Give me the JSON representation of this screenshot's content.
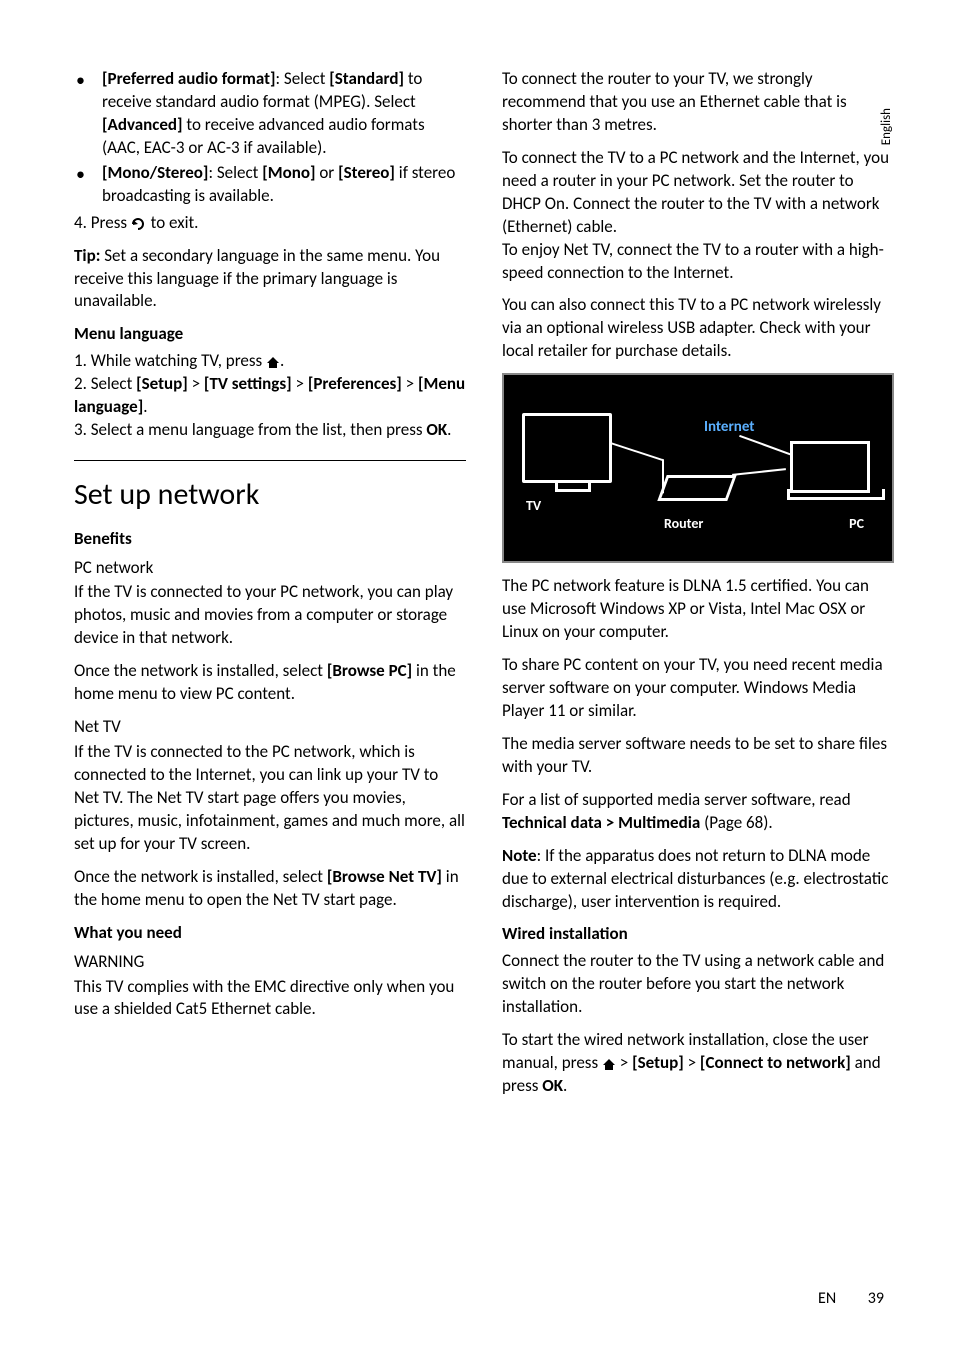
{
  "sideTab": "English",
  "left": {
    "bullet1": {
      "label": "[Preferred audio format]",
      "sep": ": Select ",
      "opt1": "[Standard]",
      "rest1": " to receive standard audio format (MPEG). Select ",
      "opt2": "[Advanced]",
      "rest2": " to receive advanced audio formats (AAC, EAC-3 or AC-3 if available)."
    },
    "bullet2": {
      "label": "[Mono/Stereo]",
      "sep": ": Select ",
      "opt1": "[Mono]",
      "mid": " or ",
      "opt2": "[Stereo]",
      "rest": " if stereo broadcasting is available."
    },
    "step4a": "4. Press ",
    "step4b": " to exit.",
    "tipLabel": "Tip:",
    "tipText": " Set a secondary language in the same menu. You receive this language if the primary language is unavailable.",
    "menuLangH": "Menu language",
    "ml1a": "1. While watching TV, press ",
    "ml1b": ".",
    "ml2a": "2. Select ",
    "ml2b": "[Setup]",
    "ml2c": " > ",
    "ml2d": "[TV settings]",
    "ml2e": " > ",
    "ml2f": "[Preferences]",
    "ml2g": " > ",
    "ml2h": "[Menu language]",
    "ml2i": ".",
    "ml3a": "3. Select a menu language from the list, then press ",
    "ml3b": "OK",
    "ml3c": ".",
    "h1": "Set up network",
    "benefitsH": "Benefits",
    "pcnetH": "PC network",
    "pcnet1": "If the TV is connected to your PC network, you can play photos, music and movies from a computer or storage device in that network.",
    "pcnet2a": "Once the network is installed, select ",
    "pcnet2b": "[Browse PC]",
    "pcnet2c": " in the home menu to view PC content.",
    "nettvH": "Net TV",
    "nettv1": "If the TV is connected to the PC network, which is connected to the Internet, you can link up your TV to Net TV. The Net TV start page offers you movies, pictures, music, infotainment, games and much more, all set up for your TV screen.",
    "nettv2a": "Once the network is installed, select ",
    "nettv2b": "[Browse Net TV]",
    "nettv2c": " in the home menu to open the Net TV start page.",
    "wynH": "What you need",
    "warnH": "WARNING",
    "warn1": "This TV complies with the EMC directive only when you use a shielded Cat5 Ethernet cable."
  },
  "right": {
    "p1": "To connect the router to your TV, we strongly recommend that you use an Ethernet cable that is shorter than 3 metres.",
    "p2": "To connect the TV to a PC network and the Internet, you need a router in your PC network. Set the router to DHCP On. Connect the router to the TV with a network (Ethernet) cable.",
    "p2b": "To enjoy Net TV, connect the TV to a router with a high-speed connection to the Internet.",
    "p3": "You can also connect this TV to a PC network wirelessly via an optional wireless USB adapter. Check with your local retailer for purchase details.",
    "diagram": {
      "tv": "TV",
      "internet": "Internet",
      "router": "Router",
      "pc": "PC"
    },
    "p4": "The PC network feature is DLNA 1.5 certified. You can use Microsoft Windows XP or Vista, Intel Mac OSX or Linux on your computer.",
    "p5": "To share PC content on your TV, you need recent media server software on your computer. Windows Media Player 11 or similar.",
    "p6": "The media server software needs to be set to share files with your TV.",
    "p7a": "For a list of supported media server software, read ",
    "p7b": "Technical data > Multimedia",
    "p7c": " (Page 68).",
    "p8a": "Note",
    "p8b": ": If the apparatus does not return to DLNA mode due to external electrical disturbances (e.g. electrostatic discharge), user intervention is required.",
    "wiredH": "Wired installation",
    "w1": "Connect the router to the TV using a network cable and switch on the router before you start the network installation.",
    "w2a": "To start the wired network installation, close the user manual, press ",
    "w2b": " > ",
    "w2c": "[Setup]",
    "w2d": " > ",
    "w2e": "[Connect to network]",
    "w2f": " and press ",
    "w2g": "OK",
    "w2h": "."
  },
  "footer": {
    "lang": "EN",
    "page": "39"
  }
}
